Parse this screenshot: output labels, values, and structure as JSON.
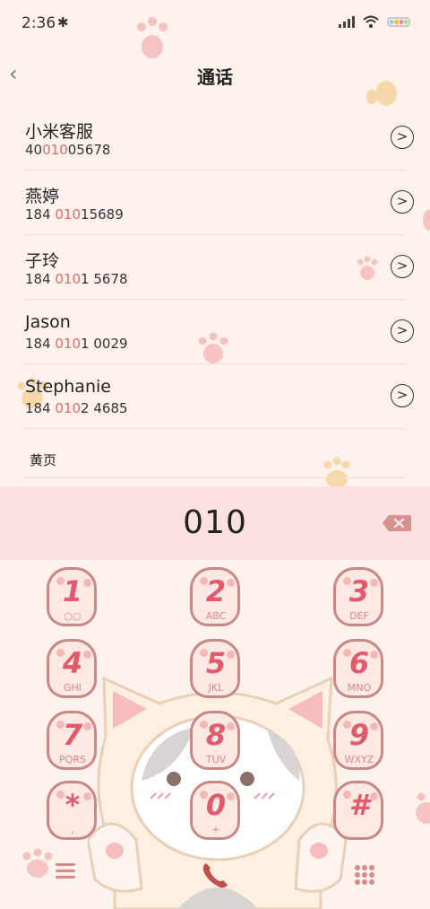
{
  "status": {
    "time": "2:36",
    "bluetooth_icon": "bluetooth-icon",
    "signal_icon": "signal-icon",
    "wifi_icon": "wifi-icon",
    "battery_icon": "battery-icon"
  },
  "header": {
    "title": "通话",
    "back_icon": "back-arrow-icon"
  },
  "contacts": [
    {
      "name": "小米客服",
      "num_pre": "40",
      "num_hl": "010",
      "num_post": "05678"
    },
    {
      "name": "燕婷",
      "num_pre": "184 ",
      "num_hl": "010",
      "num_post": "15689"
    },
    {
      "name": "子玲",
      "num_pre": "184 ",
      "num_hl": "010",
      "num_post": "1 5678"
    },
    {
      "name": "Jason",
      "num_pre": "184 ",
      "num_hl": "010",
      "num_post": "1 0029"
    },
    {
      "name": "Stephanie",
      "num_pre": "184 ",
      "num_hl": "010",
      "num_post": "2 4685"
    }
  ],
  "yellow_pages": "黄页",
  "input": {
    "digits": "010",
    "delete_icon": "backspace-icon"
  },
  "keypad": [
    {
      "digit": "1",
      "letters": "○○"
    },
    {
      "digit": "2",
      "letters": "ABC"
    },
    {
      "digit": "3",
      "letters": "DEF"
    },
    {
      "digit": "4",
      "letters": "GHI"
    },
    {
      "digit": "5",
      "letters": "JKL"
    },
    {
      "digit": "6",
      "letters": "MNO"
    },
    {
      "digit": "7",
      "letters": "PQRS"
    },
    {
      "digit": "8",
      "letters": "TUV"
    },
    {
      "digit": "9",
      "letters": "WXYZ"
    },
    {
      "digit": "*",
      "letters": ","
    },
    {
      "digit": "0",
      "letters": "+"
    },
    {
      "digit": "#",
      "letters": ""
    }
  ],
  "bottom": {
    "menu_icon": "menu-icon",
    "call_icon": "phone-icon",
    "keypad_icon": "keypad-grid-icon"
  },
  "colors": {
    "accent": "#e8696d",
    "bar": "#fde1e1",
    "background": "#fdf3ec"
  }
}
